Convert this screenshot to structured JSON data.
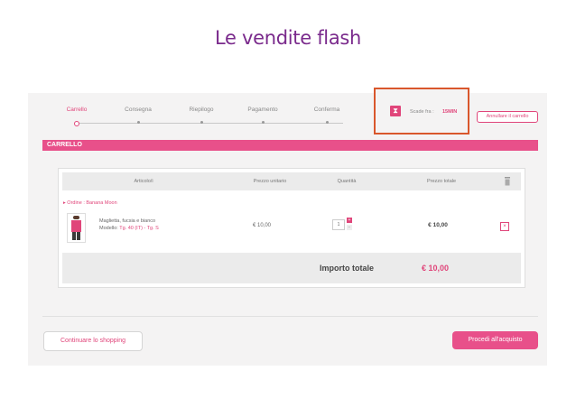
{
  "slide": {
    "title": "Le vendite flash"
  },
  "steps": [
    "Carrello",
    "Consegna",
    "Riepilogo",
    "Pagamento",
    "Conferma"
  ],
  "timer": {
    "label": "Scade fra :",
    "value": "15MIN",
    "icon": "hourglass-icon"
  },
  "cancel_cart": "Annullare il carrello",
  "cart_bar": "CARRELLO",
  "table": {
    "headers": {
      "articles": "Articolo/i",
      "unit_price": "Prezzo unitario",
      "quantity": "Quantità",
      "total_price": "Prezzo totale"
    },
    "order_label": "Ordine : Banana Moon",
    "item": {
      "name": "Maglietta, fucsia e bianco",
      "model_prefix": "Modello:",
      "model_value": "Tg. 40 (IT) - Tg. S",
      "unit_price": "€ 10,00",
      "quantity": "1",
      "total_price": "€ 10,00"
    },
    "total_label": "Importo totale",
    "total_value": "€ 10,00"
  },
  "buttons": {
    "continue": "Continuare lo shopping",
    "proceed": "Procedi all'acquisto"
  },
  "colors": {
    "accent": "#e8508a",
    "title": "#7a2a8c",
    "highlight_box": "#d9572c"
  }
}
